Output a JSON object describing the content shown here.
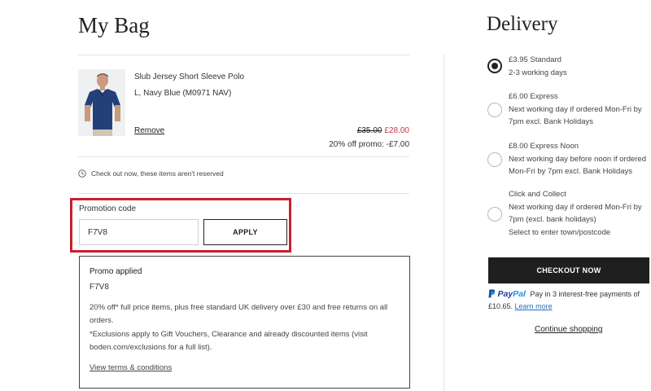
{
  "bag": {
    "title": "My Bag",
    "item": {
      "name": "Slub Jersey Short Sleeve Polo",
      "variant": "L, Navy Blue (M0971 NAV)",
      "remove_label": "Remove",
      "price_original": "£35.00",
      "price_sale": "£28.00",
      "promo_discount": "20% off promo: -£7.00",
      "image_icon": "polo-shirt-model"
    },
    "reserve_note": "Check out now, these items aren't reserved"
  },
  "promotion": {
    "label": "Promotion code",
    "input_value": "F7V8",
    "apply_label": "APPLY",
    "applied_title": "Promo applied",
    "applied_code": "F7V8",
    "description": "20% off* full price items, plus free standard UK delivery over £30 and free returns on all orders.",
    "exclusions": "*Exclusions apply to Gift Vouchers, Clearance and already discounted items (visit boden.com/exclusions for a full list).",
    "terms_link": "View terms & conditions"
  },
  "delivery": {
    "title": "Delivery",
    "options": [
      {
        "line1": "£3.95 Standard",
        "line2": "2-3 working days",
        "selected": true
      },
      {
        "line1": "£6.00 Express",
        "line2": "Next working day if ordered Mon-Fri by 7pm excl. Bank Holidays",
        "selected": false
      },
      {
        "line1": "£8.00 Express Noon",
        "line2": "Next working day before noon if ordered Mon-Fri by 7pm excl. Bank Holidays",
        "selected": false
      },
      {
        "line1": "Click and Collect",
        "line2": "Next working day if ordered Mon-Fri by 7pm (excl. bank holidays)",
        "line3": "Select to enter town/postcode",
        "selected": false
      }
    ]
  },
  "checkout": {
    "button_label": "CHECKOUT NOW",
    "paypal_pay": "Pay",
    "paypal_pal": "Pal",
    "paypal_text": "Pay in 3 interest-free payments of £10.65.",
    "learn_more": "Learn more",
    "continue_label": "Continue shopping"
  },
  "colors": {
    "highlight_border": "#c8202f",
    "sale_price": "#c2384b",
    "checkout_bg": "#1f1f1f",
    "paypal_dark": "#1a3e8a",
    "paypal_light": "#2a8fd8",
    "link_blue": "#2a6db8"
  }
}
